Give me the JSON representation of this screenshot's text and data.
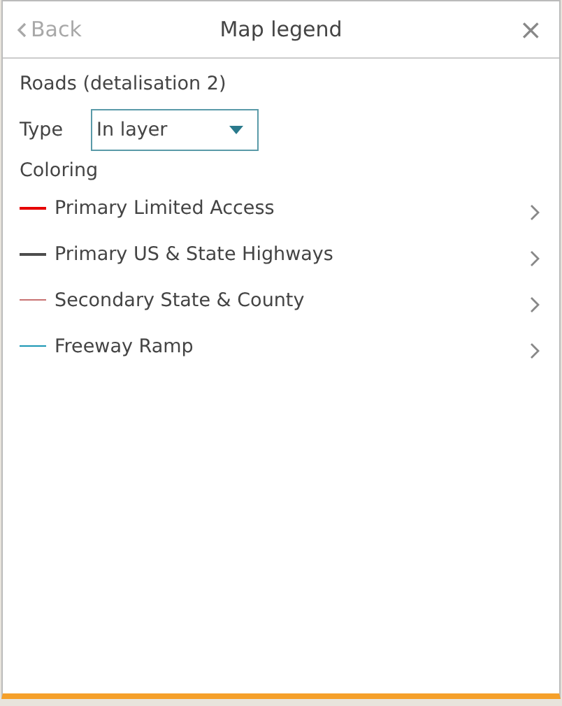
{
  "header": {
    "back": "Back",
    "title": "Map legend",
    "close": "×"
  },
  "layer": {
    "title": "Roads (detalisation 2)"
  },
  "type_field": {
    "label": "Type",
    "value": "In layer"
  },
  "coloring": {
    "heading": "Coloring",
    "items": [
      {
        "label": "Primary Limited Access",
        "color": "#e60000",
        "kind": "thick"
      },
      {
        "label": "Primary US & State Highways",
        "color": "#4d4d4d",
        "kind": "thick"
      },
      {
        "label": "Secondary State & County",
        "color": "#c87272",
        "kind": "thin"
      },
      {
        "label": "Freeway Ramp",
        "color": "#1a96b4",
        "kind": "thin"
      }
    ]
  }
}
